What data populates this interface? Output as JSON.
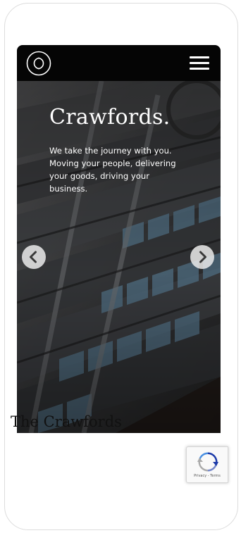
{
  "header": {
    "logo": "crawfords-cc-logo",
    "menu_icon": "hamburger-menu-icon"
  },
  "hero": {
    "title": "Crawfords.",
    "text": "We take the journey with you. Moving your people, delivering your goods, driving your business.",
    "prev_icon": "chevron-left-icon",
    "next_icon": "chevron-right-icon"
  },
  "section": {
    "title": "The Crawfords",
    "title_cut": "/ ___ _ _ _ _ _ _ _ _"
  },
  "recaptcha": {
    "text": "Privacy - Terms"
  },
  "colors": {
    "header_bg": "#050505",
    "hero_overlay": "#2a2a2b",
    "text_light": "#ffffff",
    "text_dark": "#111111"
  }
}
